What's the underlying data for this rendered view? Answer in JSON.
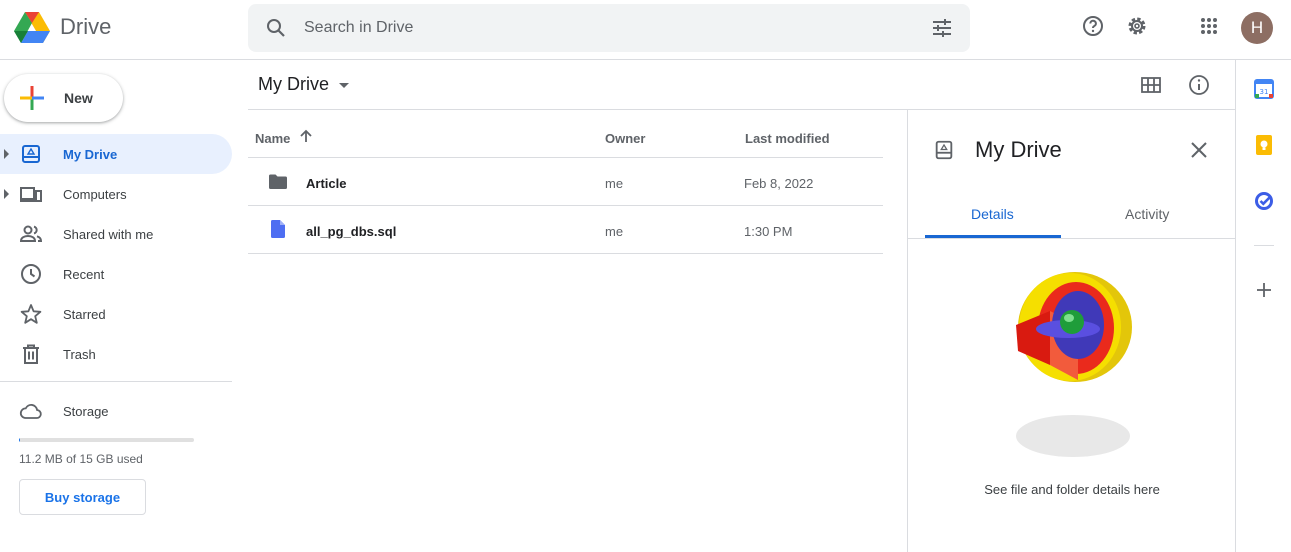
{
  "app": {
    "name": "Drive"
  },
  "search": {
    "placeholder": "Search in Drive"
  },
  "header": {
    "avatar_letter": "H"
  },
  "sidebar": {
    "new_label": "New",
    "items": [
      {
        "label": "My Drive",
        "active": true
      },
      {
        "label": "Computers"
      },
      {
        "label": "Shared with me"
      },
      {
        "label": "Recent"
      },
      {
        "label": "Starred"
      },
      {
        "label": "Trash"
      }
    ],
    "storage_label": "Storage",
    "storage_used": "11.2 MB of 15 GB used",
    "storage_fraction": 0.001,
    "buy_storage": "Buy storage"
  },
  "main": {
    "location": "My Drive",
    "columns": {
      "name": "Name",
      "owner": "Owner",
      "modified": "Last modified"
    },
    "files": [
      {
        "name": "Article",
        "owner": "me",
        "modified": "Feb 8, 2022",
        "type": "folder-icon"
      },
      {
        "name": "all_pg_dbs.sql",
        "owner": "me",
        "modified": "1:30 PM",
        "type": "document-icon"
      }
    ]
  },
  "details": {
    "title": "My Drive",
    "tabs": [
      "Details",
      "Activity"
    ],
    "empty_text": "See file and folder details here"
  },
  "rail": {
    "calendar_day": "31"
  },
  "colors": {
    "accent": "#1967d2",
    "active_bg": "#e8f0fe",
    "doc": "#4e6ef2"
  }
}
